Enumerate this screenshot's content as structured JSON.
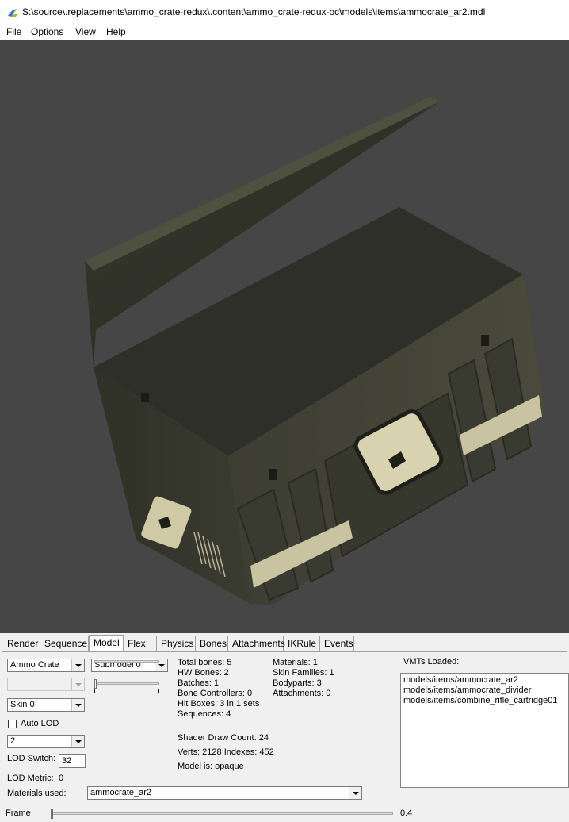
{
  "window": {
    "title": "S:\\source\\.replacements\\ammo_crate-redux\\.content\\ammo_crate-redux-oc\\models\\items\\ammocrate_ar2.mdl",
    "icon": "hlmv-app-icon"
  },
  "menu": [
    "File",
    "Options",
    "View",
    "Help"
  ],
  "tabs": [
    "Render",
    "Sequence",
    "Model",
    "Flex",
    "Physics",
    "Bones",
    "Attachments",
    "IKRule",
    "Events"
  ],
  "active_tab": "Model",
  "model_tab": {
    "body_combo": "Ammo Crate",
    "submodel_combo": "Submodel 0",
    "empty_combo": "",
    "skin_combo": "Skin 0",
    "auto_lod_label": "Auto LOD",
    "auto_lod_checked": false,
    "lod_combo": "2",
    "lod_switch_label": "LOD Switch:",
    "lod_switch_value": "32",
    "lod_metric_label": "LOD Metric:",
    "lod_metric_value": "0",
    "materials_used_label": "Materials used:",
    "materials_used_value": "ammocrate_ar2",
    "stats_left": [
      "Total bones: 5",
      "HW Bones: 2",
      "Batches: 1",
      "Bone Controllers: 0",
      "Hit Boxes: 3 in 1 sets",
      "Sequences: 4"
    ],
    "stats_right": [
      "Materials: 1",
      "Skin Families: 1",
      "Bodyparts: 3",
      "Attachments: 0"
    ],
    "shader_draw_count": "Shader Draw Count: 24",
    "verts_indexes": "Verts: 2128  Indexes: 452",
    "model_is": "Model is: opaque",
    "vmts_label": "VMTs Loaded:",
    "vmts": [
      "models/items/ammocrate_ar2",
      "models/items/ammocrate_divider",
      "models/items/combine_rifle_cartridge01"
    ]
  },
  "frame": {
    "label": "Frame",
    "value": "0.4"
  },
  "colors": {
    "viewport_bg": "#464646",
    "crate_body": "#3a3b30",
    "crate_stripe": "#c9c3a2"
  }
}
